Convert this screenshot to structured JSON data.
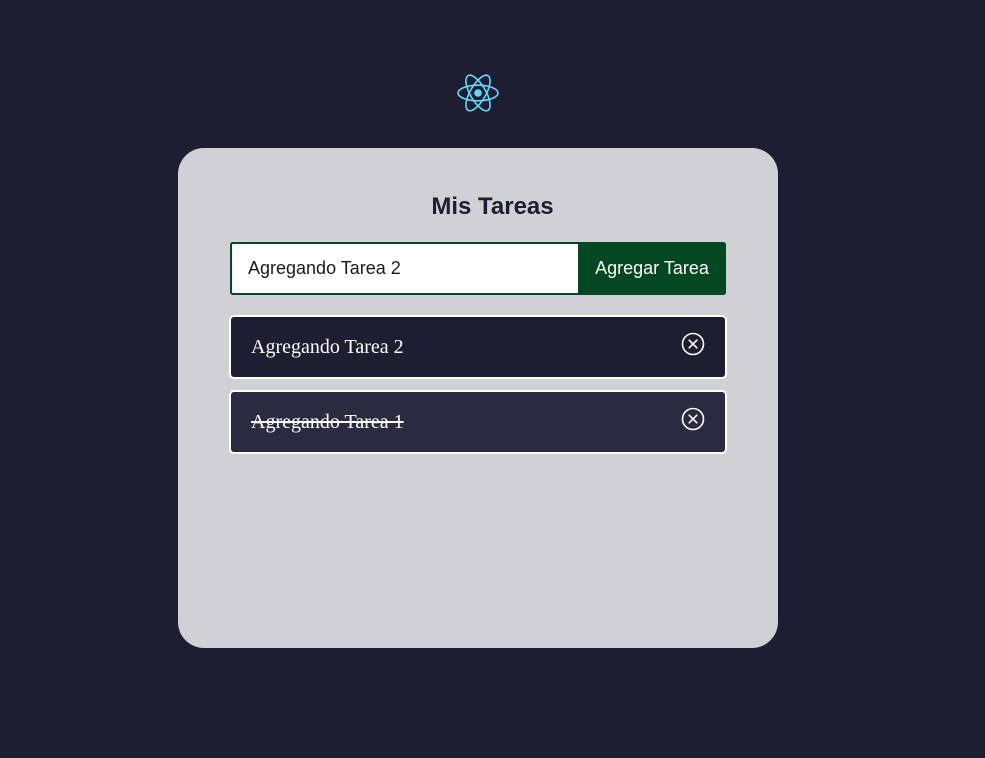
{
  "logo": {
    "icon": "react-atom-icon",
    "color": "#61dafb"
  },
  "card": {
    "title": "Mis Tareas"
  },
  "form": {
    "input_value": "Agregando Tarea 2",
    "submit_label": "Agregar Tarea"
  },
  "tasks": [
    {
      "text": "Agregando Tarea 2",
      "completed": false,
      "icon": "close-circle-icon"
    },
    {
      "text": "Agregando Tarea 1",
      "completed": true,
      "icon": "close-circle-icon"
    }
  ],
  "colors": {
    "background": "#1d1e32",
    "card": "#d1d0d5",
    "accent": "#034820",
    "task_bg": "#1d1e32",
    "task_done_bg": "#2a2b40"
  }
}
